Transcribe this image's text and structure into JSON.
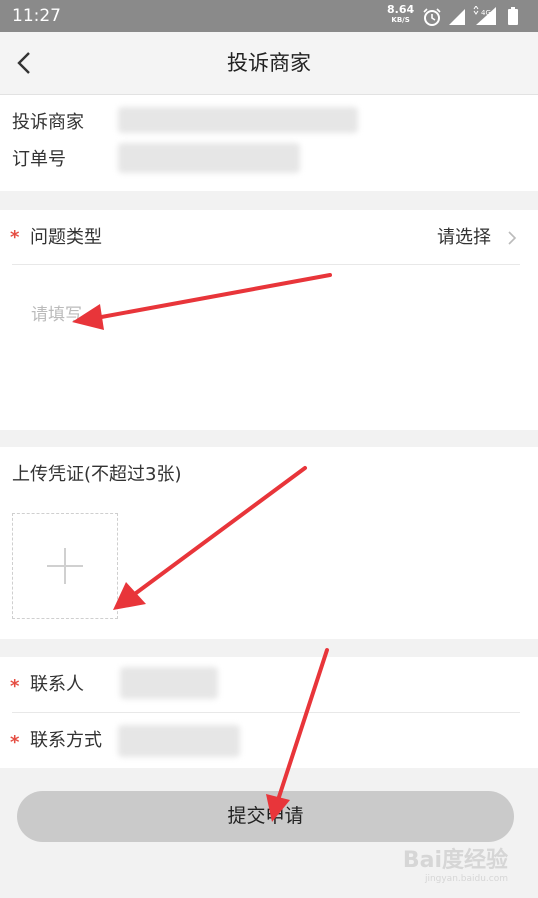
{
  "status_bar": {
    "time": "11:27",
    "net_speed": "8.64",
    "net_unit": "KB/S",
    "network": "4G"
  },
  "header": {
    "title": "投诉商家"
  },
  "merchant": {
    "label": "投诉商家",
    "value": "",
    "order_label": "订单号",
    "order_value": ""
  },
  "issue": {
    "label": "问题类型",
    "select_text": "请选择",
    "description_placeholder": "请填写"
  },
  "upload": {
    "label": "上传凭证(不超过3张)"
  },
  "contact": {
    "name_label": "联系人",
    "method_label": "联系方式"
  },
  "submit": {
    "label": "提交申请"
  },
  "watermark": {
    "text": "Bai度经验",
    "sub": "jingyan.baidu.com"
  },
  "colors": {
    "required_star": "#e54d42",
    "annotation_arrow": "#e8353a",
    "submit_bg": "#cacaca"
  }
}
